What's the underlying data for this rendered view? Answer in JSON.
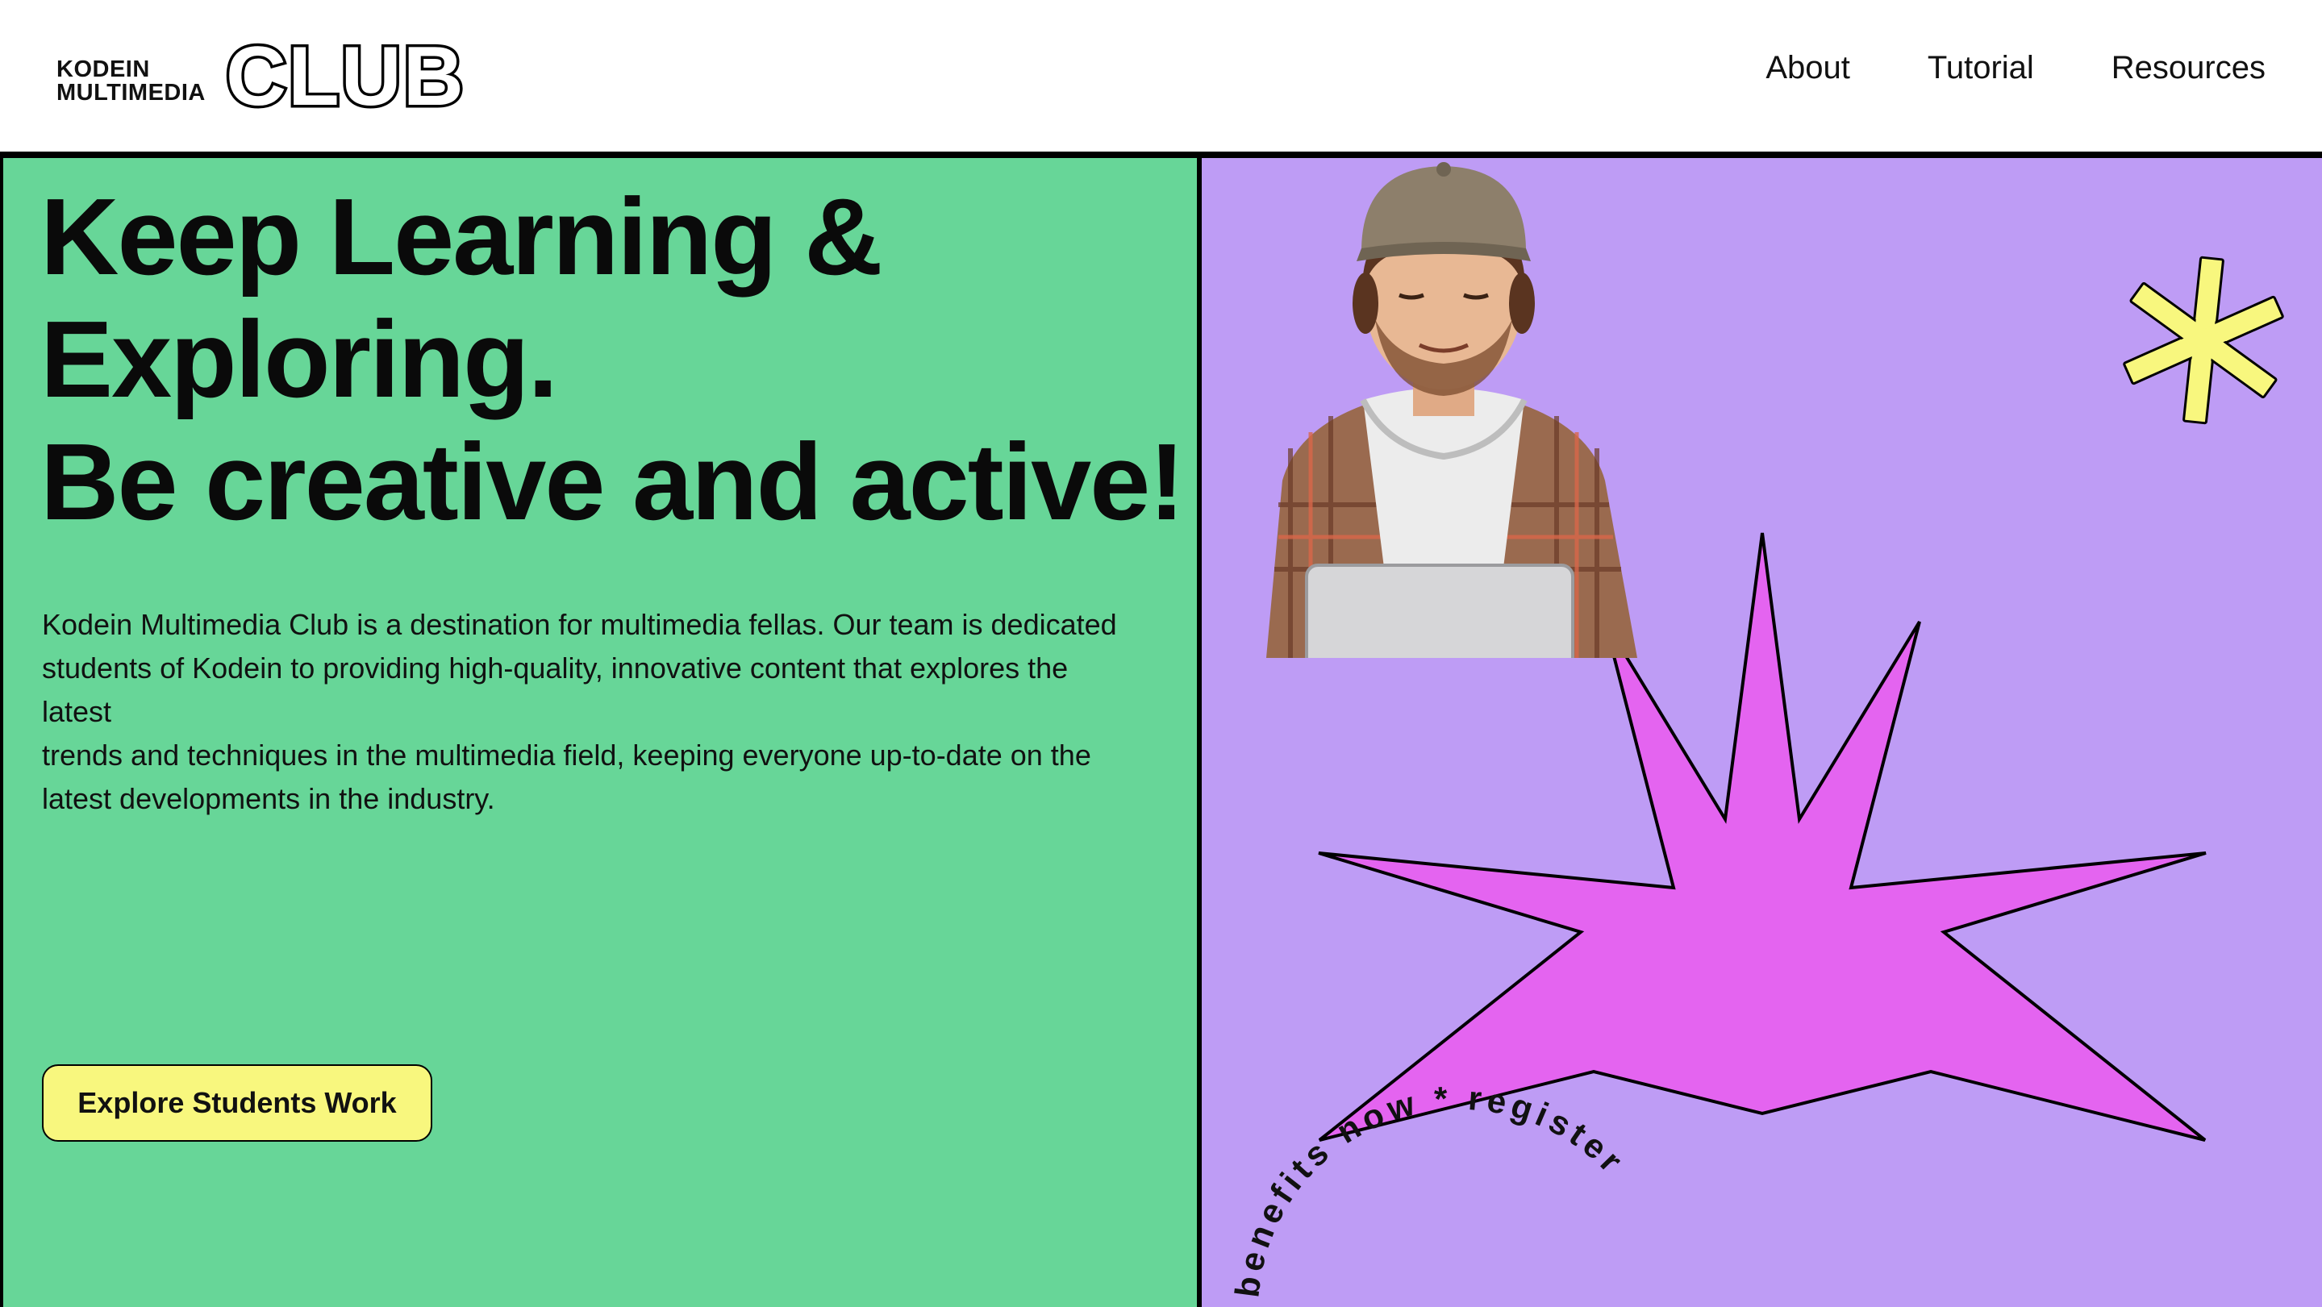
{
  "header": {
    "logo": {
      "line1": "KODEIN",
      "line2": "MULTIMEDIA",
      "wordmark": "CLUB"
    },
    "nav": [
      "About",
      "Tutorial",
      "Resources"
    ]
  },
  "hero": {
    "headline": [
      "Keep Learning &",
      "Exploring.",
      "Be creative and active!"
    ],
    "description": [
      "Kodein Multimedia Club is a destination for multimedia fellas. Our team is dedicated",
      "students of Kodein to providing high-quality, innovative content that explores the",
      "latest",
      "trends and techniques in the multimedia field, keeping everyone up-to-date on the",
      "latest developments in the industry."
    ],
    "cta_label": "Explore Students Work"
  },
  "visual": {
    "badge_text": "benefits now * register",
    "icons": [
      "asterisk-icon",
      "starburst-icon"
    ],
    "colors": {
      "left_panel": "#67d698",
      "right_panel": "#be9cf5",
      "starburst": "#e464f0",
      "asterisk": "#f8f77e",
      "cta": "#f8f77e"
    }
  }
}
